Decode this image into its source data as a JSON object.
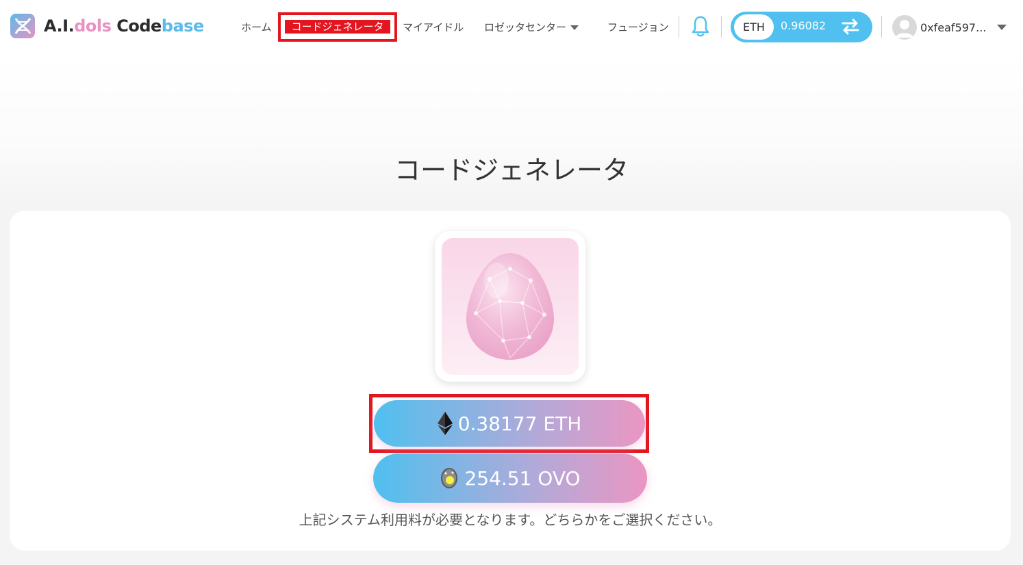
{
  "header": {
    "logo": {
      "part_a": "A.I.",
      "part_dols": "dols",
      "part_code": " Code",
      "part_base": "base"
    },
    "nav": {
      "home": "ホーム",
      "code_generator": "コードジェネレータ",
      "my_idol": "マイアイドル",
      "rosetta_center": "ロゼッタセンター",
      "fusion": "フュージョン"
    },
    "wallet": {
      "currency": "ETH",
      "balance": "0.96082"
    },
    "user": {
      "address": "0xfeaf597..."
    }
  },
  "main": {
    "title": "コードジェネレータ",
    "pay_eth": "0.38177 ETH",
    "pay_ovo": "254.51 OVO",
    "note": "上記システム利用料が必要となります。どちらかをご選択ください。"
  },
  "colors": {
    "accent_blue": "#4fc0ef",
    "accent_pink": "#eb96c2",
    "highlight_red": "#e3151f"
  },
  "icons": [
    "logo-icon",
    "bell-icon",
    "swap-icon",
    "avatar-icon",
    "ethereum-icon",
    "ovo-coin-icon"
  ]
}
